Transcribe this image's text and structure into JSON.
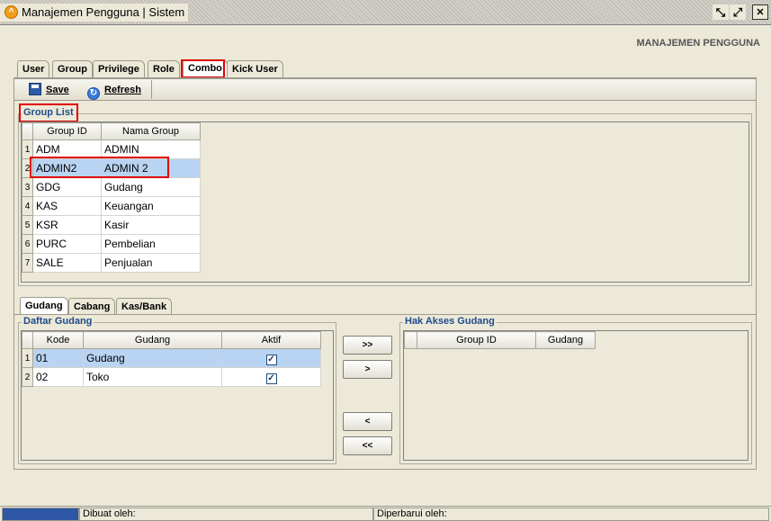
{
  "window": {
    "title": "Manajemen Pengguna | Sistem",
    "icon": "app-icon",
    "controls": [
      {
        "name": "restore-icon",
        "glyph": "⤡"
      },
      {
        "name": "maximize-icon",
        "glyph": "⤢"
      },
      {
        "name": "close-icon",
        "glyph": "✕"
      }
    ]
  },
  "page_heading": "MANAJEMEN PENGGUNA",
  "main_tabs": [
    {
      "label": "User"
    },
    {
      "label": "Group"
    },
    {
      "label": "Privilege"
    },
    {
      "label": "Role"
    },
    {
      "label": "Combo",
      "active": true
    },
    {
      "label": "Kick User"
    }
  ],
  "toolbar": {
    "save_label": "Save",
    "refresh_label": "Refresh"
  },
  "group_list": {
    "title": "Group List",
    "columns": [
      "Group ID",
      "Nama Group"
    ],
    "rows": [
      {
        "no": "1",
        "id": "ADM",
        "name": "ADMIN"
      },
      {
        "no": "2",
        "id": "ADMIN2",
        "name": "ADMIN 2",
        "selected": true
      },
      {
        "no": "3",
        "id": "GDG",
        "name": "Gudang"
      },
      {
        "no": "4",
        "id": "KAS",
        "name": "Keuangan"
      },
      {
        "no": "5",
        "id": "KSR",
        "name": "Kasir"
      },
      {
        "no": "6",
        "id": "PURC",
        "name": "Pembelian"
      },
      {
        "no": "7",
        "id": "SALE",
        "name": "Penjualan"
      }
    ]
  },
  "sub_tabs": [
    {
      "label": "Gudang",
      "active": true
    },
    {
      "label": "Cabang"
    },
    {
      "label": "Kas/Bank"
    }
  ],
  "daftar_gudang": {
    "title": "Daftar Gudang",
    "columns": [
      "Kode",
      "Gudang",
      "Aktif"
    ],
    "rows": [
      {
        "no": "1",
        "kode": "01",
        "gudang": "Gudang",
        "aktif": true,
        "selected": true
      },
      {
        "no": "2",
        "kode": "02",
        "gudang": "Toko",
        "aktif": true
      }
    ]
  },
  "move_buttons": {
    "add_all": ">>",
    "add_one": ">",
    "remove_one": "<",
    "remove_all": "<<"
  },
  "hak_akses": {
    "title": "Hak Akses Gudang",
    "columns": [
      "Group ID",
      "Gudang"
    ]
  },
  "statusbar": {
    "created_by_label": "Dibuat oleh:",
    "updated_by_label": "Diperbarui oleh:"
  },
  "colors": {
    "selection": "#b9d3f2",
    "highlight_box": "#e00000",
    "group_title": "#1f4b8c"
  }
}
